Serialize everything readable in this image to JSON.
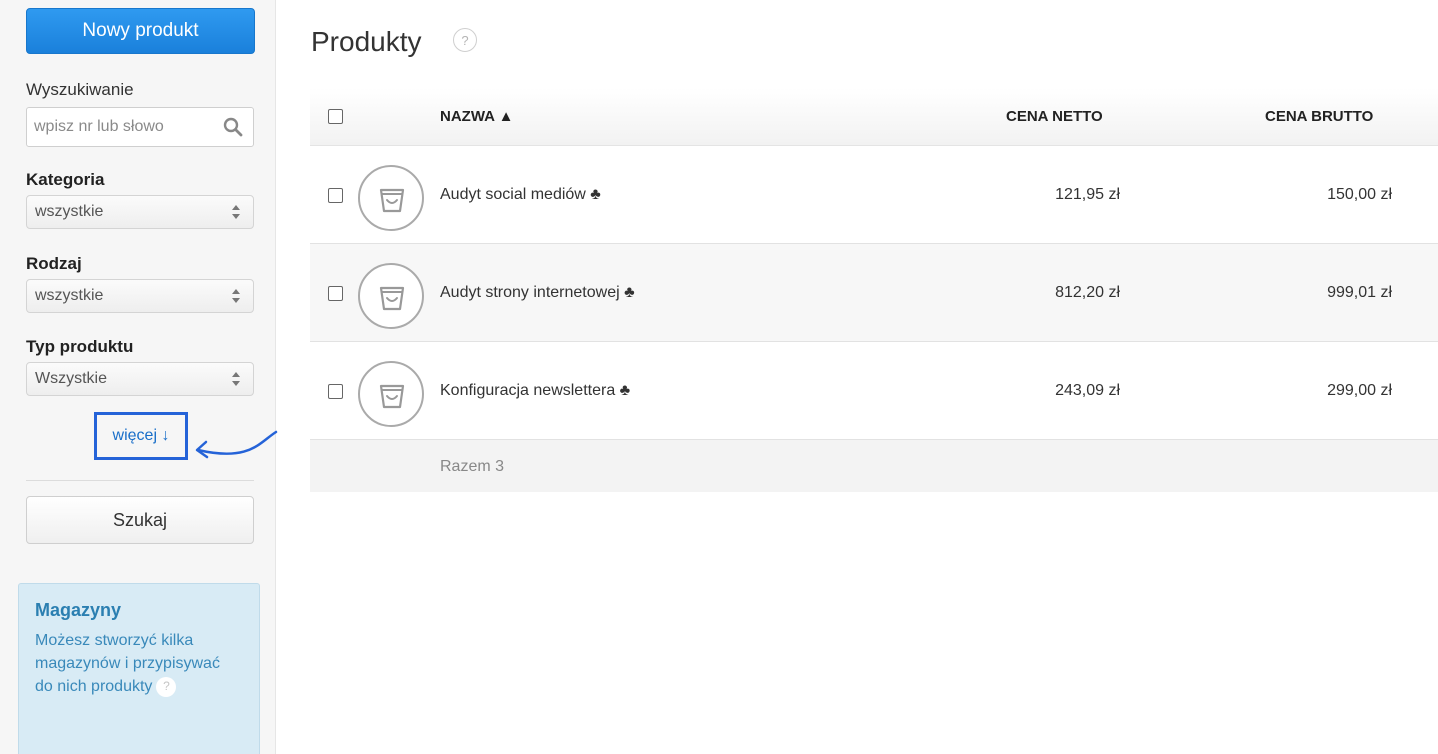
{
  "sidebar": {
    "new_product_label": "Nowy produkt",
    "search": {
      "label": "Wyszukiwanie",
      "placeholder": "wpisz nr lub słowo",
      "value": ""
    },
    "filters": [
      {
        "label": "Kategoria",
        "value": "wszystkie"
      },
      {
        "label": "Rodzaj",
        "value": "wszystkie"
      },
      {
        "label": "Typ produktu",
        "value": "Wszystkie"
      }
    ],
    "more_label": "więcej ↓",
    "search_button_label": "Szukaj",
    "info": {
      "title": "Magazyny",
      "text": "Możesz stworzyć kilka magazynów i przypisywać do nich produkty",
      "help": "?"
    }
  },
  "main": {
    "title": "Produkty",
    "help": "?",
    "table": {
      "columns": {
        "name": "NAZWA ▲",
        "net": "CENA NETTO",
        "gross": "CENA BRUTTO"
      },
      "rows": [
        {
          "name": "Audyt social mediów ♣",
          "net": "121,95 zł",
          "gross": "150,00 zł"
        },
        {
          "name": "Audyt strony internetowej ♣",
          "net": "812,20 zł",
          "gross": "999,01 zł"
        },
        {
          "name": "Konfiguracja newslettera ♣",
          "net": "243,09 zł",
          "gross": "299,00 zł"
        }
      ],
      "footer": "Razem 3"
    }
  },
  "colors": {
    "primary": "#1a80db",
    "annotation": "#2563d8",
    "info_bg": "#d8ebf5"
  },
  "icons": [
    "search-icon",
    "select-arrows-icon",
    "product-basket-icon",
    "help-icon",
    "annotation-arrow"
  ]
}
